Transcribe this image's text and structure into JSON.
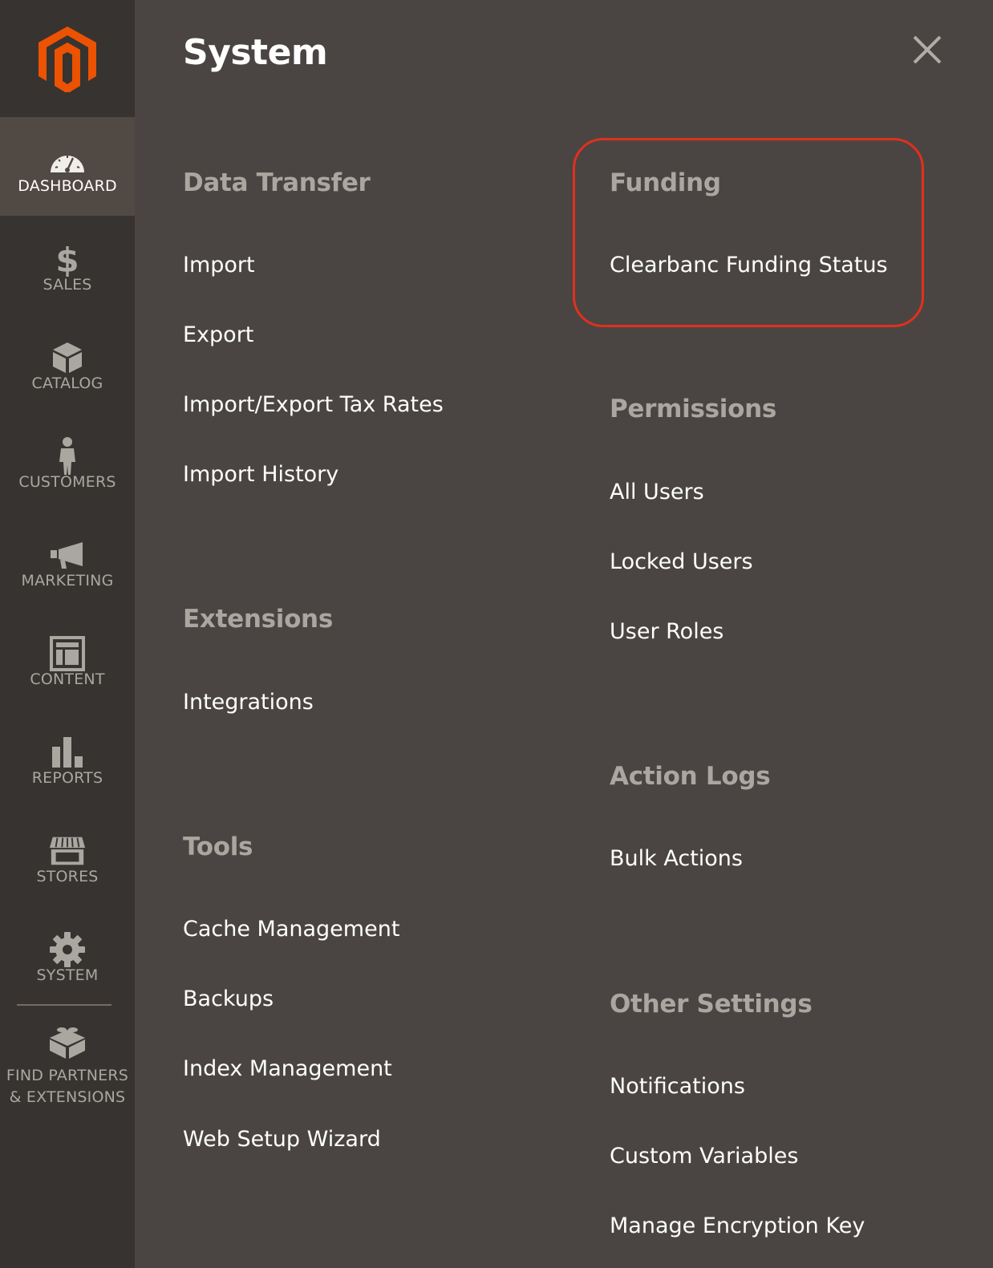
{
  "colors": {
    "sidebar_bg": "#373330",
    "panel_bg": "#4a4542",
    "active_item_bg": "#514943",
    "accent_orange": "#eb5202",
    "highlight_red": "#e0301e",
    "section_title": "#aaa6a0",
    "link_text": "#ffffff"
  },
  "sidebar": {
    "logo": "magento-logo-icon",
    "items": [
      {
        "label": "DASHBOARD",
        "icon": "dashboard-gauge-icon",
        "active": true
      },
      {
        "label": "SALES",
        "icon": "dollar-icon"
      },
      {
        "label": "CATALOG",
        "icon": "box-icon"
      },
      {
        "label": "CUSTOMERS",
        "icon": "person-icon"
      },
      {
        "label": "MARKETING",
        "icon": "megaphone-icon"
      },
      {
        "label": "CONTENT",
        "icon": "layout-icon"
      },
      {
        "label": "REPORTS",
        "icon": "bar-chart-icon"
      },
      {
        "label": "STORES",
        "icon": "storefront-icon"
      },
      {
        "label": "SYSTEM",
        "icon": "gear-icon"
      }
    ],
    "partners": {
      "line1": "FIND PARTNERS",
      "line2": "& EXTENSIONS",
      "icon": "lego-brick-icon"
    }
  },
  "panel": {
    "title": "System",
    "close_icon": "close-icon",
    "data_transfer": {
      "title": "Data Transfer",
      "links": [
        "Import",
        "Export",
        "Import/Export Tax Rates",
        "Import History"
      ]
    },
    "extensions": {
      "title": "Extensions",
      "links": [
        "Integrations"
      ]
    },
    "tools": {
      "title": "Tools",
      "links": [
        "Cache Management",
        "Backups",
        "Index Management",
        "Web Setup Wizard"
      ]
    },
    "funding": {
      "title": "Funding",
      "links": [
        "Clearbanc Funding Status"
      ]
    },
    "permissions": {
      "title": "Permissions",
      "links": [
        "All Users",
        "Locked Users",
        "User Roles"
      ]
    },
    "action_logs": {
      "title": "Action Logs",
      "links": [
        "Bulk Actions"
      ]
    },
    "other_settings": {
      "title": "Other Settings",
      "links": [
        "Notifications",
        "Custom Variables",
        "Manage Encryption Key"
      ]
    }
  }
}
